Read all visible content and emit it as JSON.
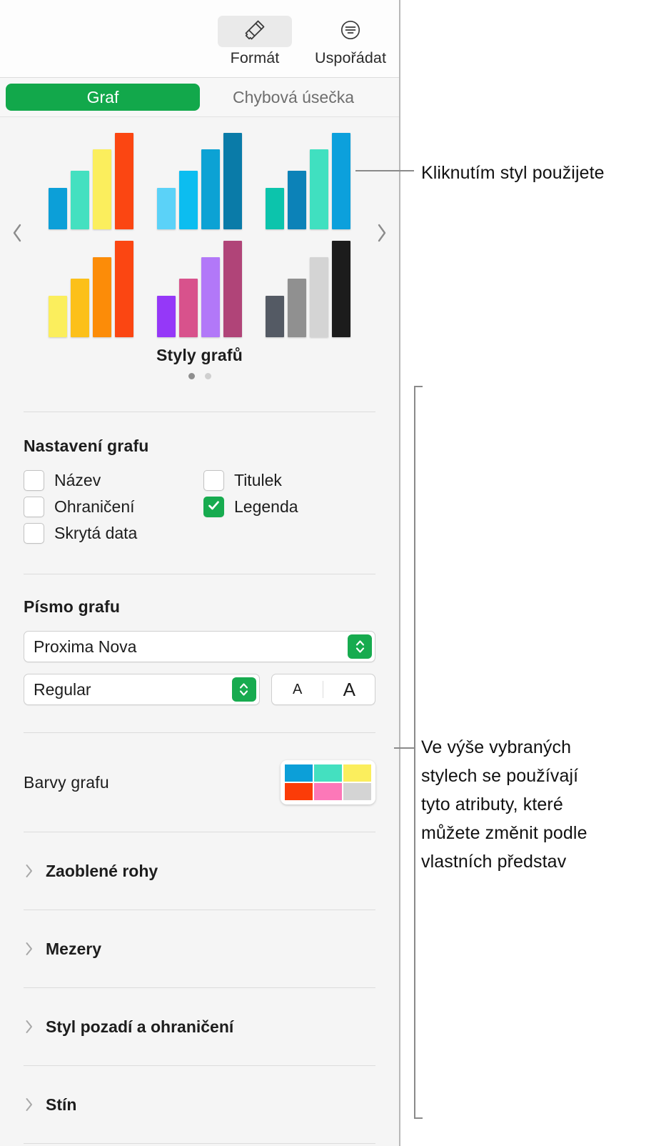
{
  "toolbar": {
    "format_label": "Formát",
    "format_icon": "paintbrush-icon",
    "arrange_label": "Uspořádat",
    "arrange_icon": "arrange-icon"
  },
  "tabs": [
    {
      "label": "Graf",
      "selected": true
    },
    {
      "label": "Chybová úsečka",
      "selected": false
    }
  ],
  "gallery": {
    "title": "Styly grafů",
    "prev_icon": "chevron-left-icon",
    "next_icon": "chevron-right-icon",
    "page_dots": [
      true,
      false
    ],
    "thumbnails": [
      {
        "name": "style-1-cool-mixed",
        "colors": [
          "#0C9FD8",
          "#44E0C0",
          "#FBEE5D",
          "#FB4612"
        ],
        "heights": [
          58,
          82,
          112,
          135
        ]
      },
      {
        "name": "style-2-blue-ramp",
        "colors": [
          "#5BD2F8",
          "#0CBDF0",
          "#0CA2D4",
          "#0A7BA8"
        ],
        "heights": [
          58,
          82,
          112,
          135
        ]
      },
      {
        "name": "style-3-teal-blue",
        "colors": [
          "#0CC4AC",
          "#0C82B8",
          "#40E0C0",
          "#0CA0DC"
        ],
        "heights": [
          58,
          82,
          112,
          135
        ]
      },
      {
        "name": "style-4-warm-ramp",
        "colors": [
          "#FBEE5D",
          "#FCC019",
          "#FC8C08",
          "#FB4612"
        ],
        "heights": [
          58,
          82,
          112,
          135
        ]
      },
      {
        "name": "style-5-purple-mix",
        "colors": [
          "#9538F8",
          "#D8528C",
          "#B278F8",
          "#B04478"
        ],
        "heights": [
          58,
          82,
          112,
          135
        ]
      },
      {
        "name": "style-6-grayscale",
        "colors": [
          "#545A64",
          "#909090",
          "#D4D4D4",
          "#1C1C1C"
        ],
        "heights": [
          58,
          82,
          112,
          135
        ]
      }
    ]
  },
  "chart_settings": {
    "title": "Nastavení grafu",
    "options": [
      {
        "label": "Název",
        "checked": false
      },
      {
        "label": "Titulek",
        "checked": false
      },
      {
        "label": "Ohraničení",
        "checked": false
      },
      {
        "label": "Legenda",
        "checked": true
      },
      {
        "label": "Skrytá data",
        "checked": false
      }
    ],
    "check_color": "#17AB4F"
  },
  "chart_font": {
    "title": "Písmo grafu",
    "family_value": "Proxima Nova",
    "style_value": "Regular",
    "size_decrease_label": "A",
    "size_increase_label": "A",
    "stepper_icon": "stepper-up-down-icon"
  },
  "chart_colors": {
    "label": "Barvy grafu",
    "swatches": [
      "#0C9FD8",
      "#44E0C0",
      "#FBEE5D",
      "#FB3C08",
      "#FC78B8",
      "#D4D4D4"
    ]
  },
  "disclosure_rows": [
    {
      "label": "Zaoblené rohy",
      "icon": "chevron-right-icon"
    },
    {
      "label": "Mezery",
      "icon": "chevron-right-icon"
    },
    {
      "label": "Styl pozadí a ohraničení",
      "icon": "chevron-right-icon"
    },
    {
      "label": "Stín",
      "icon": "chevron-right-icon"
    }
  ],
  "annotations": {
    "callout_1": "Kliknutím styl použijete",
    "callout_2_line1": "Ve výše vybraných",
    "callout_2_line2": "stylech se používají",
    "callout_2_line3": "tyto atributy, které",
    "callout_2_line4": "můžete změnit podle",
    "callout_2_line5": "vlastních představ"
  }
}
